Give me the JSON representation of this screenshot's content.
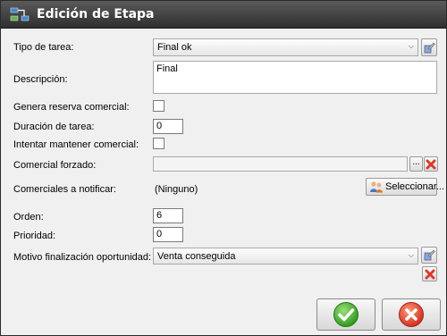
{
  "window": {
    "title": "Edición de Etapa"
  },
  "form": {
    "tipo_label": "Tipo de tarea:",
    "tipo_value": "Final ok",
    "descripcion_label": "Descripción:",
    "descripcion_value": "Final",
    "genera_reserva_label": "Genera reserva comercial:",
    "genera_reserva_checked": false,
    "duracion_label": "Duración de tarea:",
    "duracion_value": "0",
    "intentar_label": "Intentar mantener comercial:",
    "intentar_checked": false,
    "comercial_forzado_label": "Comercial forzado:",
    "comercial_forzado_value": "",
    "browse_label": "...",
    "comerciales_label": "Comerciales a notificar:",
    "comerciales_value": "(Ninguno)",
    "seleccionar_label": "Seleccionar...",
    "orden_label": "Orden:",
    "orden_value": "6",
    "prioridad_label": "Prioridad:",
    "prioridad_value": "0",
    "motivo_label": "Motivo finalización oportunidad:",
    "motivo_value": "Venta conseguida"
  },
  "icons": {
    "accept": "green-check-icon",
    "cancel": "red-x-icon",
    "edit": "wrench-edit-icon",
    "clear": "red-x-icon",
    "users": "users-icon"
  },
  "colors": {
    "titlebar": "#3a3a3a",
    "accept": "#3fae2a",
    "cancel": "#d93a2a"
  }
}
